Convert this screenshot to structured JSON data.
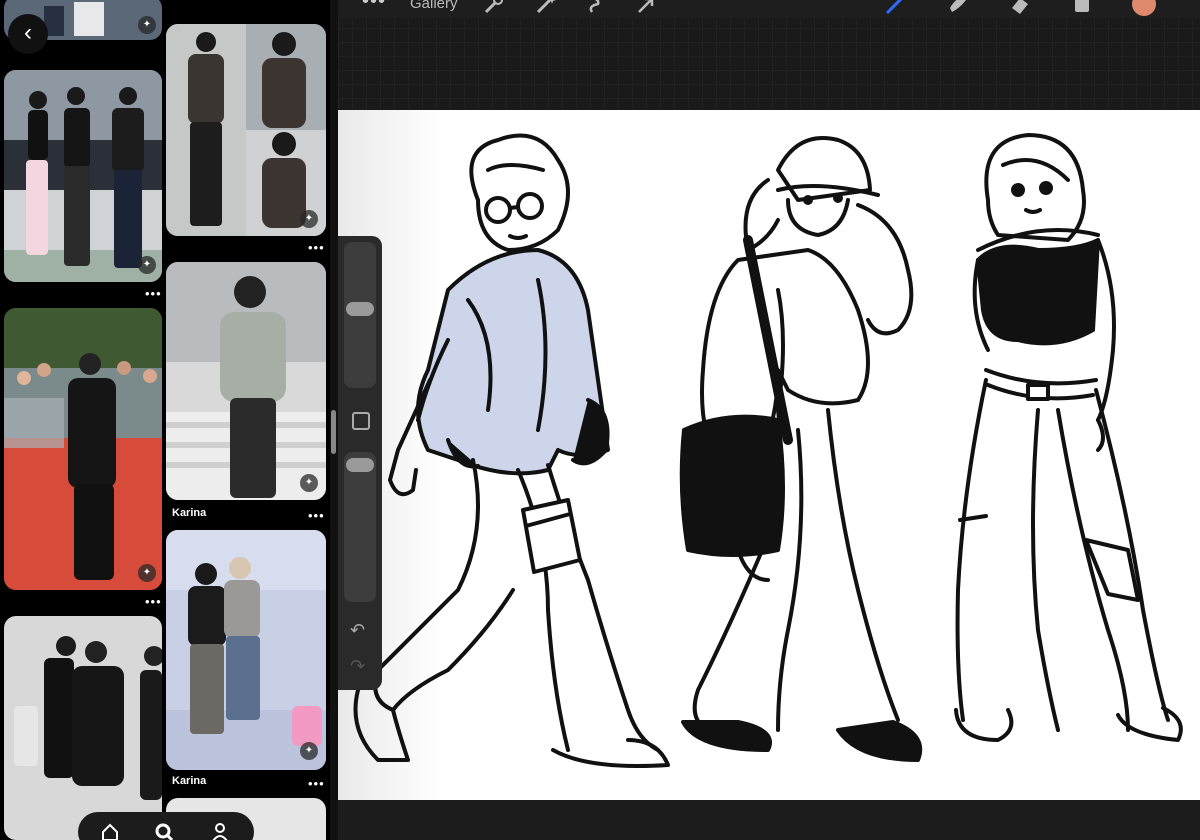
{
  "left_panel": {
    "header_text": "",
    "pins": [
      {
        "label": ""
      },
      {
        "label": ""
      },
      {
        "label": ""
      },
      {
        "label": "Karina"
      },
      {
        "label": ""
      },
      {
        "label": "Karina"
      }
    ],
    "more_dots": "•••",
    "nav_items": [
      "home-icon",
      "search-icon",
      "profile-icon"
    ]
  },
  "procreate": {
    "gallery_label": "Gallery",
    "more_dots": "•••",
    "tools": [
      "wrench-icon",
      "magic-wand-icon",
      "selection-icon",
      "transform-icon",
      "brush-icon",
      "smudge-icon",
      "eraser-icon",
      "layers-icon"
    ],
    "color": "#e08a6d",
    "undo_glyph": "↶",
    "redo_glyph": "↷",
    "figure_hoodie_color": "#cdd5ea"
  }
}
